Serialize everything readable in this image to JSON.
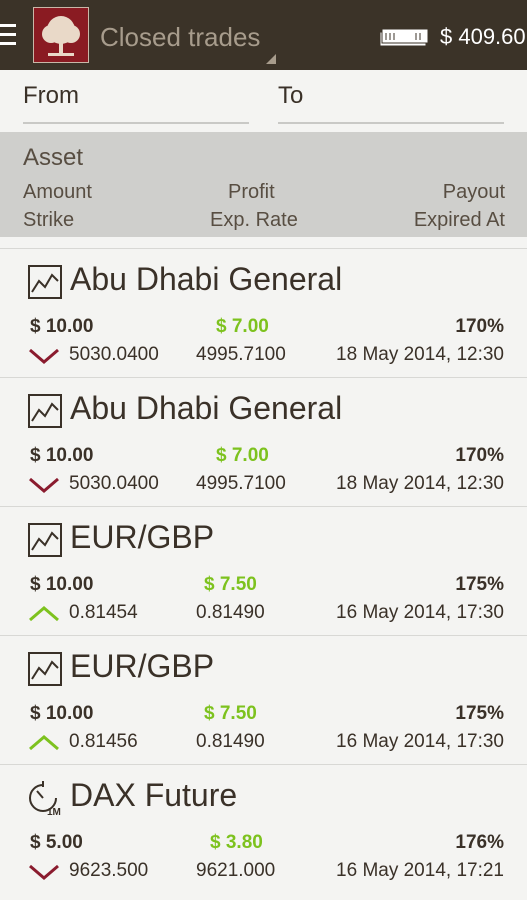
{
  "topbar": {
    "title": "Closed trades",
    "balance": "$ 409.60"
  },
  "filter": {
    "from_label": "From",
    "to_label": "To"
  },
  "columns": {
    "asset": "Asset",
    "amount": "Amount",
    "profit": "Profit",
    "payout": "Payout",
    "strike": "Strike",
    "exp_rate": "Exp. Rate",
    "expired_at": "Expired At"
  },
  "trades": [
    {
      "asset": "Abu Dhabi General",
      "icon": "chart-icon",
      "amount": "$ 10.00",
      "profit": "$ 7.00",
      "payout": "170%",
      "direction": "down",
      "strike": "5030.0400",
      "exp_rate": "4995.7100",
      "expired_at": "18 May 2014, 12:30"
    },
    {
      "asset": "Abu Dhabi General",
      "icon": "chart-icon",
      "amount": "$ 10.00",
      "profit": "$ 7.00",
      "payout": "170%",
      "direction": "down",
      "strike": "5030.0400",
      "exp_rate": "4995.7100",
      "expired_at": "18 May 2014, 12:30"
    },
    {
      "asset": "EUR/GBP",
      "icon": "chart-icon",
      "amount": "$ 10.00",
      "profit": "$ 7.50",
      "payout": "175%",
      "direction": "up",
      "strike": "0.81454",
      "exp_rate": "0.81490",
      "expired_at": "16 May 2014, 17:30"
    },
    {
      "asset": "EUR/GBP",
      "icon": "chart-icon",
      "amount": "$ 10.00",
      "profit": "$ 7.50",
      "payout": "175%",
      "direction": "up",
      "strike": "0.81456",
      "exp_rate": "0.81490",
      "expired_at": "16 May 2014, 17:30"
    },
    {
      "asset": "DAX Future",
      "icon": "timer-1m-icon",
      "timer_label": "1M",
      "amount": "$ 5.00",
      "profit": "$ 3.80",
      "payout": "176%",
      "direction": "down",
      "strike": "9623.500",
      "exp_rate": "9621.000",
      "expired_at": "16 May 2014, 17:21"
    }
  ],
  "colors": {
    "topbar": "#3b3328",
    "profit": "#7dc21e",
    "arrow_down": "#8a1b2e",
    "arrow_up": "#7dc21e",
    "header_bg": "#cfcfcc"
  }
}
